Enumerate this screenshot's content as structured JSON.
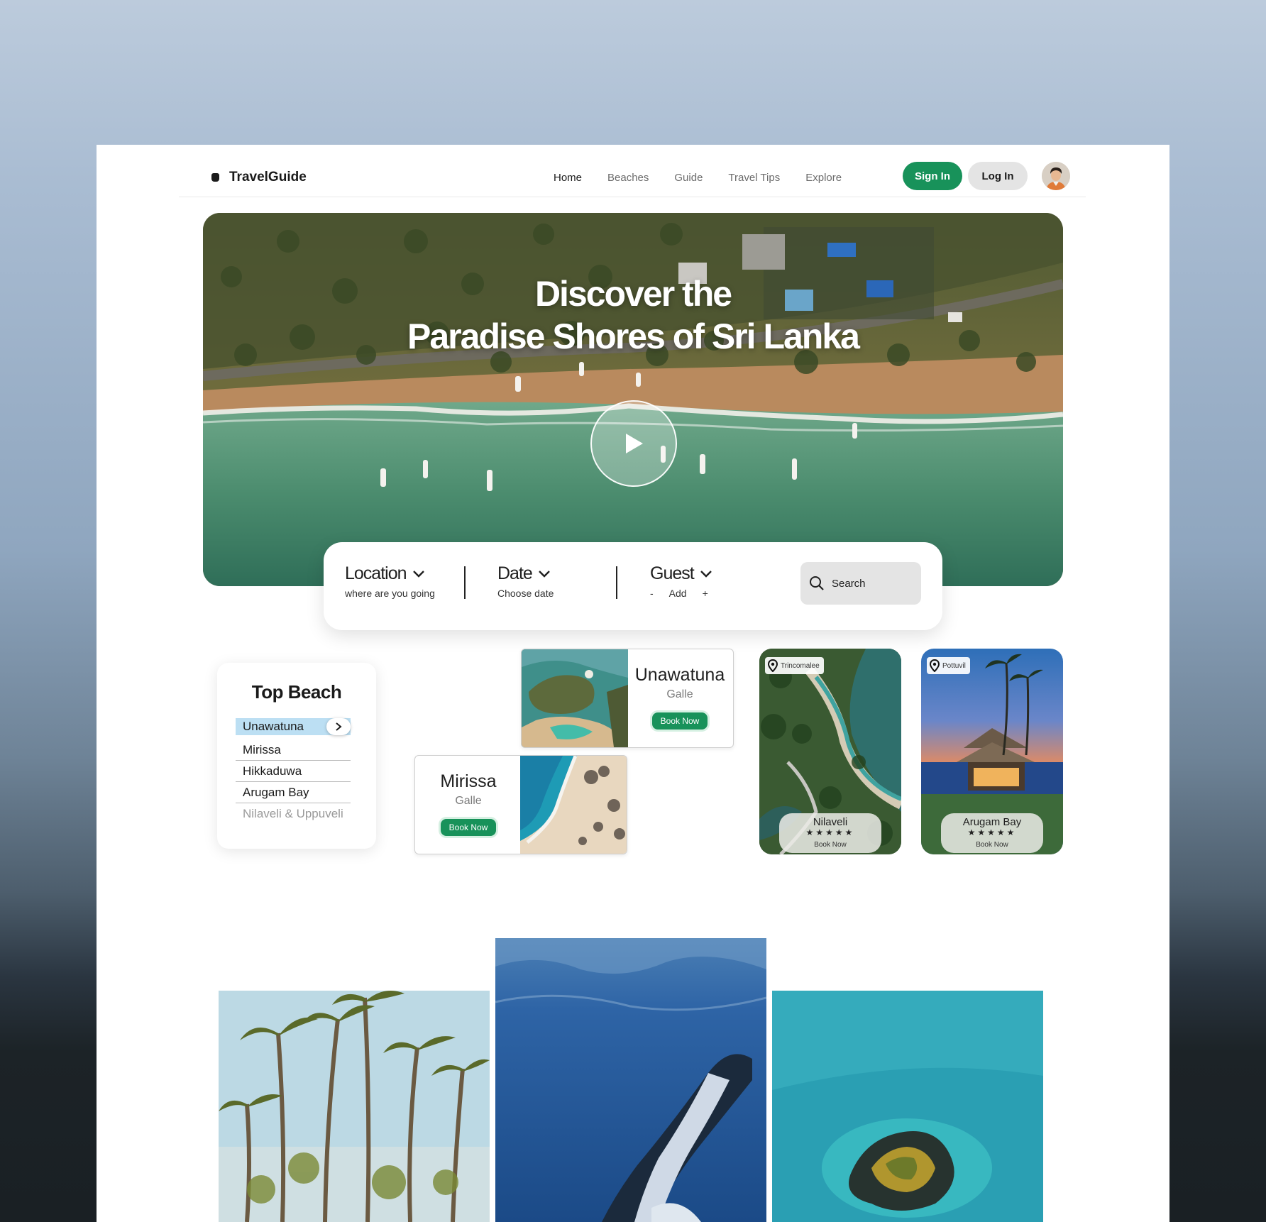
{
  "brand": {
    "name": "TravelGuide"
  },
  "nav": {
    "items": [
      "Home",
      "Beaches",
      "Guide",
      "Travel Tips",
      "Explore"
    ],
    "sign_in": "Sign In",
    "log_in": "Log In"
  },
  "hero": {
    "title_line1": "Discover the",
    "title_line2": "Paradise Shores of Sri Lanka"
  },
  "search": {
    "location_label": "Location",
    "location_sub": "where are you going",
    "date_label": "Date",
    "date_sub": "Choose date",
    "guest_label": "Guest",
    "guest_minus": "-",
    "guest_add": "Add",
    "guest_plus": "+",
    "button": "Search"
  },
  "top_beach": {
    "title": "Top Beach",
    "items": [
      "Unawatuna",
      "Mirissa",
      "Hikkaduwa",
      "Arugam Bay",
      "Nilaveli & Uppuveli"
    ]
  },
  "cards": [
    {
      "name": "Unawatuna",
      "region": "Galle",
      "button": "Book Now"
    },
    {
      "name": "Mirissa",
      "region": "Galle",
      "button": "Book Now"
    }
  ],
  "tall_cards": [
    {
      "location": "Trincomalee",
      "name": "Nilaveli",
      "stars": "★★★★★",
      "button": "Book Now"
    },
    {
      "location": "Pottuvil",
      "name": "Arugam Bay",
      "stars": "★★★★★",
      "button": "Book Now"
    }
  ],
  "colors": {
    "accent": "#18925a",
    "highlight": "#bcdff3"
  }
}
